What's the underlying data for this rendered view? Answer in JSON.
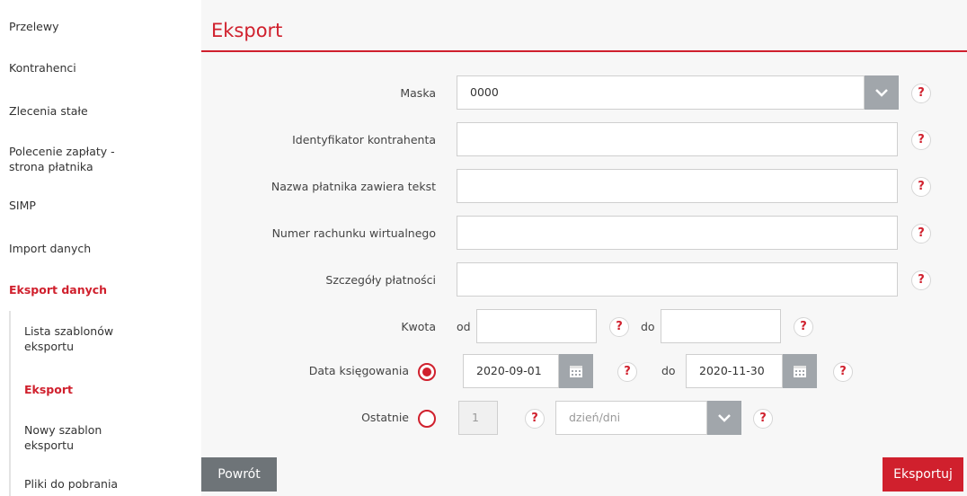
{
  "sidebar": {
    "items": [
      {
        "label": "Przelewy"
      },
      {
        "label": "Kontrahenci"
      },
      {
        "label": "Zlecenia stałe"
      },
      {
        "label": "Polecenie zapłaty -\nstrona płatnika"
      },
      {
        "label": "SIMP"
      },
      {
        "label": "Import danych"
      },
      {
        "label": "Eksport danych"
      }
    ],
    "subitems": [
      {
        "label": "Lista szablonów\neksportu"
      },
      {
        "label": "Eksport"
      },
      {
        "label": "Nowy szablon\neksportu"
      },
      {
        "label": "Pliki do pobrania"
      }
    ]
  },
  "header": {
    "title": "Eksport"
  },
  "form": {
    "mask": {
      "label": "Maska",
      "value": "0000"
    },
    "contractor_id": {
      "label": "Identyfikator kontrahenta",
      "value": ""
    },
    "payer_name": {
      "label": "Nazwa płatnika zawiera tekst",
      "value": ""
    },
    "virtual_account": {
      "label": "Numer rachunku wirtualnego",
      "value": ""
    },
    "payment_details": {
      "label": "Szczegóły płatności",
      "value": ""
    },
    "amount": {
      "label": "Kwota",
      "from_label": "od",
      "to_label": "do",
      "from_value": "",
      "to_value": ""
    },
    "booking_date": {
      "label": "Data księgowania",
      "from_value": "2020-09-01",
      "to_label": "do",
      "to_value": "2020-11-30",
      "selected": true
    },
    "last": {
      "label": "Ostatnie",
      "value": "1",
      "unit_placeholder": "dzień/dni",
      "selected": false
    },
    "help_symbol": "?"
  },
  "buttons": {
    "back": "Powrót",
    "export": "Eksportuj"
  },
  "colors": {
    "accent": "#d0202d",
    "button_gray": "#6e7478",
    "control_gray": "#a1a6ab"
  }
}
